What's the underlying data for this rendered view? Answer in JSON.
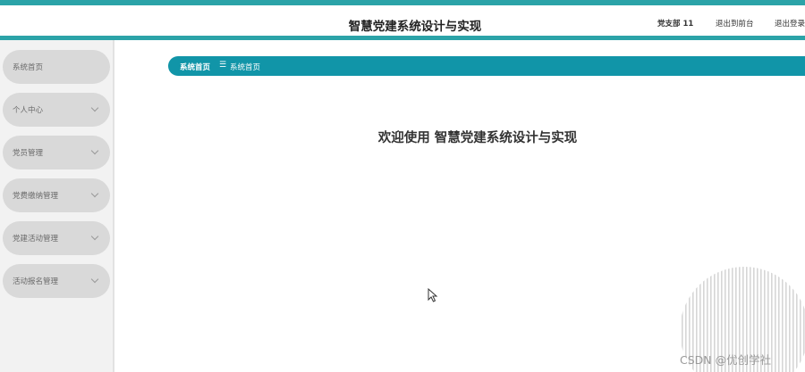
{
  "header": {
    "title": "智慧党建系统设计与实现",
    "user_label": "党支部 11",
    "front_link": "退出到前台",
    "logout_link": "退出登录"
  },
  "sidebar": {
    "items": [
      {
        "label": "系统首页",
        "has_chevron": false
      },
      {
        "label": "个人中心",
        "has_chevron": true
      },
      {
        "label": "党员管理",
        "has_chevron": true
      },
      {
        "label": "党费缴纳管理",
        "has_chevron": true
      },
      {
        "label": "党建活动管理",
        "has_chevron": true
      },
      {
        "label": "活动报名管理",
        "has_chevron": true
      }
    ]
  },
  "breadcrumb": {
    "home": "系统首页",
    "separator": "☰",
    "current": "系统首页"
  },
  "main": {
    "welcome": "欢迎使用 智慧党建系统设计与实现"
  },
  "watermark": "CSDN @优创学社",
  "colors": {
    "accent": "#2ba3a8",
    "breadcrumb_bg": "#1195a8",
    "menu_bg": "#d9d9d9",
    "sidebar_bg": "#f2f2f2"
  }
}
